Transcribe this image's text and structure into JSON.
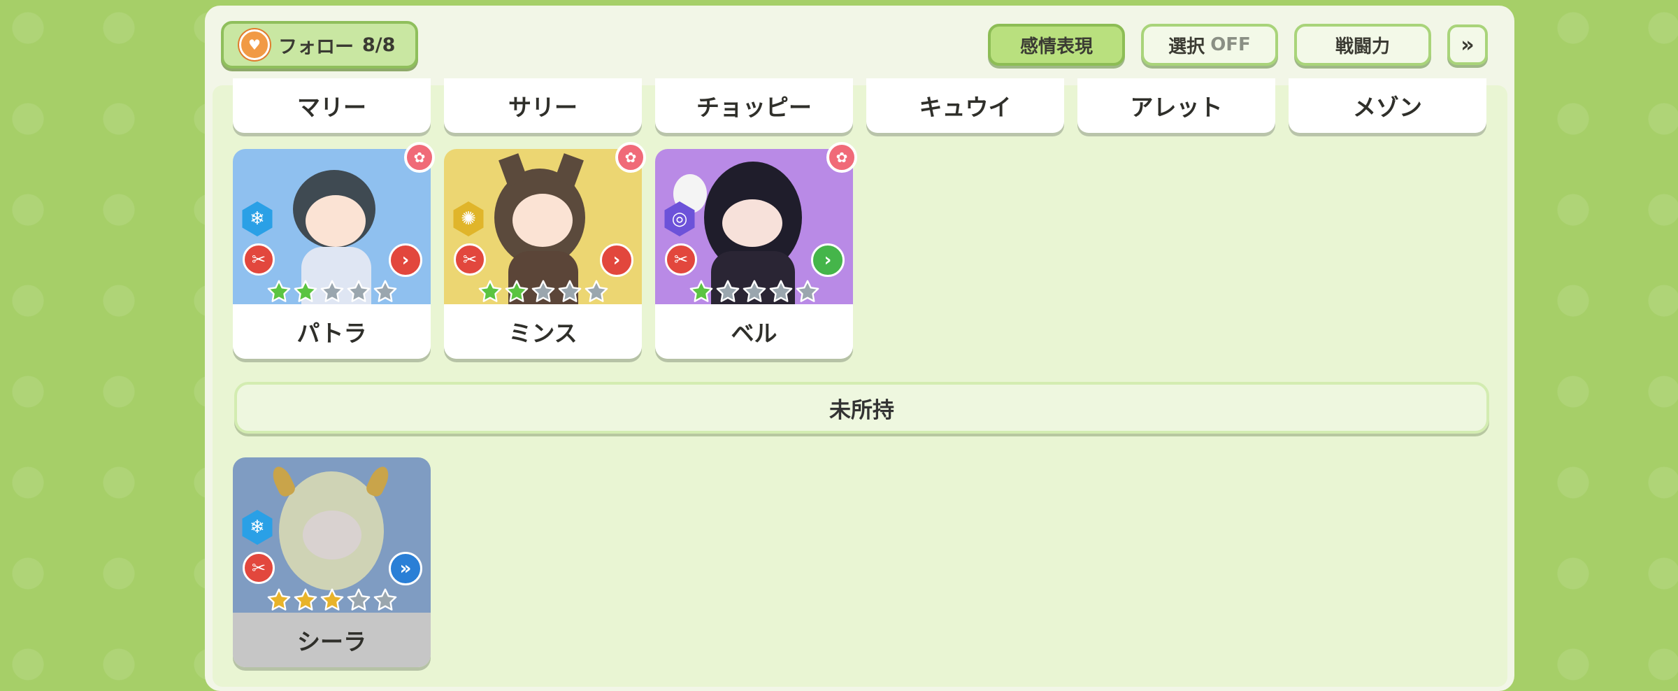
{
  "header": {
    "follow_label": "フォロー",
    "follow_count": "8/8",
    "buttons": [
      {
        "label": "感情表現",
        "state": "on"
      },
      {
        "label": "選択",
        "suffix": "OFF",
        "state": "off"
      },
      {
        "label": "戦闘力",
        "state": "off"
      }
    ],
    "collapse_icon": "double-chevron-down-icon"
  },
  "top_row_names": [
    "マリー",
    "サリー",
    "チョッピー",
    "キュウイ",
    "アレット",
    "メゾン"
  ],
  "owned": [
    {
      "name": "パトラ",
      "element": "ice",
      "element_color": "#2aa0e6",
      "element_glyph": "❄",
      "role_glyph": "✂",
      "arrow_color": "#e2473d",
      "stars": 2,
      "bg": "#8fc0ef"
    },
    {
      "name": "ミンス",
      "element": "light",
      "element_color": "#e0b52a",
      "element_glyph": "✺",
      "role_glyph": "✂",
      "arrow_color": "#e2473d",
      "stars": 2,
      "bg": "#ecd672"
    },
    {
      "name": "ベル",
      "element": "dark",
      "element_color": "#6c52d9",
      "element_glyph": "◎",
      "role_glyph": "✂",
      "arrow_color": "#45b54a",
      "stars": 1,
      "bg": "#b98ae6"
    }
  ],
  "section_title": "未所持",
  "unowned": [
    {
      "name": "シーラ",
      "element": "ice",
      "element_color": "#2aa0e6",
      "element_glyph": "❄",
      "role_glyph": "✂",
      "arrow_color": "#2a7fd6",
      "stars": 3,
      "bg": "#7f9cc2"
    }
  ],
  "colors": {
    "page_bg": "#a6cf68",
    "panel": "#f2f6e7",
    "accent_green": "#8dbd55",
    "star_green": "#5bc441",
    "star_gold": "#e8b32a",
    "star_empty": "#9aa6ae"
  }
}
